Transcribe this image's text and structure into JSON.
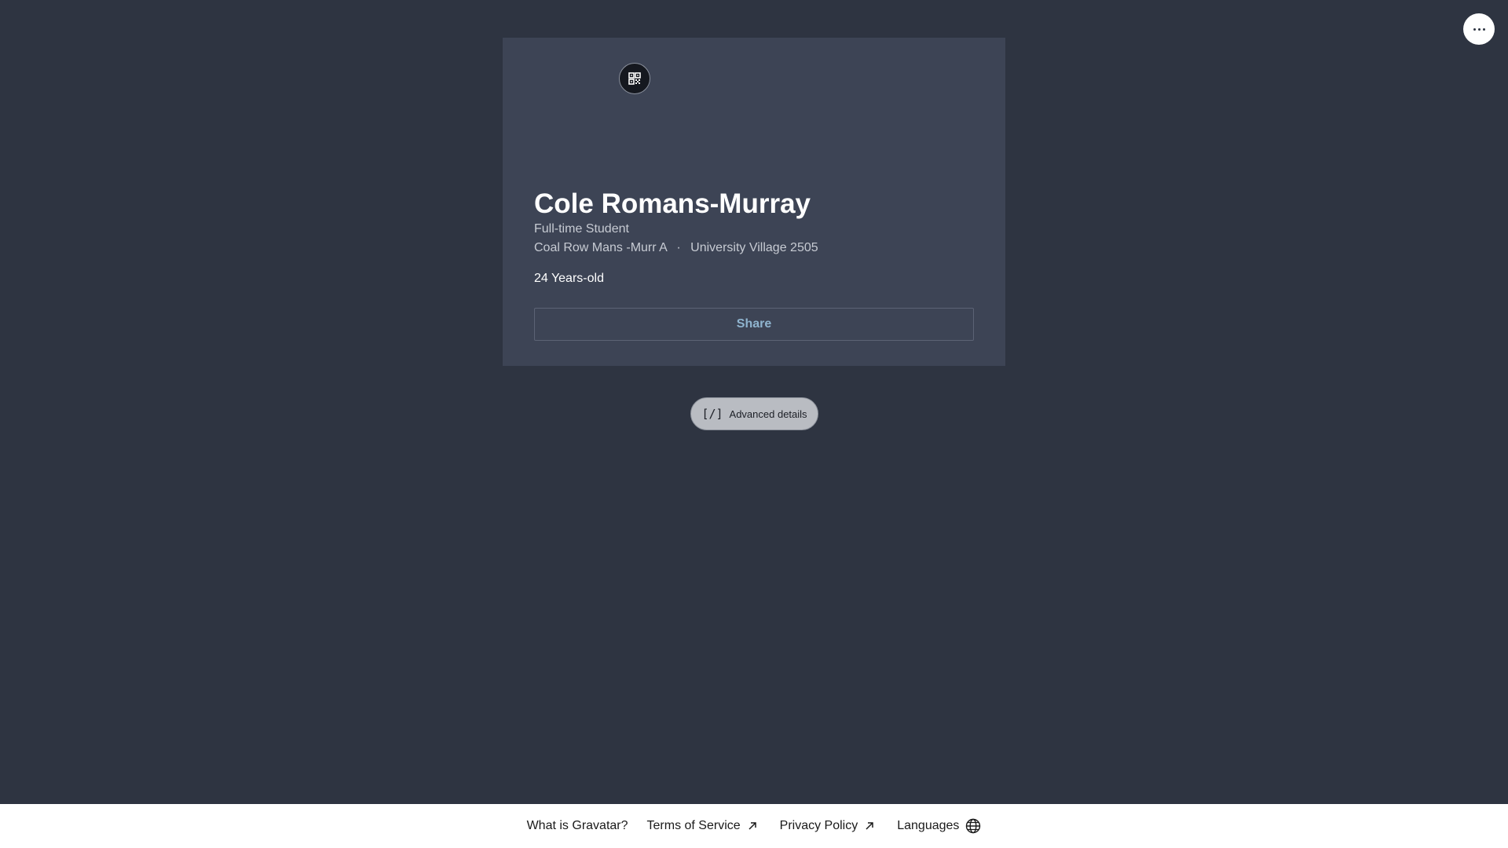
{
  "header": {
    "more_icon": "ellipsis-horizontal-icon"
  },
  "profile": {
    "qr_icon": "qr-code-icon",
    "name": "Cole Romans-Murray",
    "job_title": "Full-time Student",
    "location_primary": "Coal Row Mans -Murr A",
    "separator": "·",
    "location_secondary": "University Village 2505",
    "age": "24 Years-old",
    "share_label": "Share"
  },
  "advanced": {
    "icon": "[/]",
    "label": "Advanced details"
  },
  "footer": {
    "links": [
      {
        "label": "What is Gravatar?"
      },
      {
        "label": "Terms of Service",
        "icon": "external-arrow-icon"
      },
      {
        "label": "Privacy Policy",
        "icon": "external-arrow-icon"
      },
      {
        "label": "Languages",
        "icon": "globe-icon"
      }
    ]
  },
  "colors": {
    "background": "#2e3441",
    "card": "#3d4455",
    "share_text": "#8fb4cf",
    "footer_bg": "#ffffff"
  }
}
